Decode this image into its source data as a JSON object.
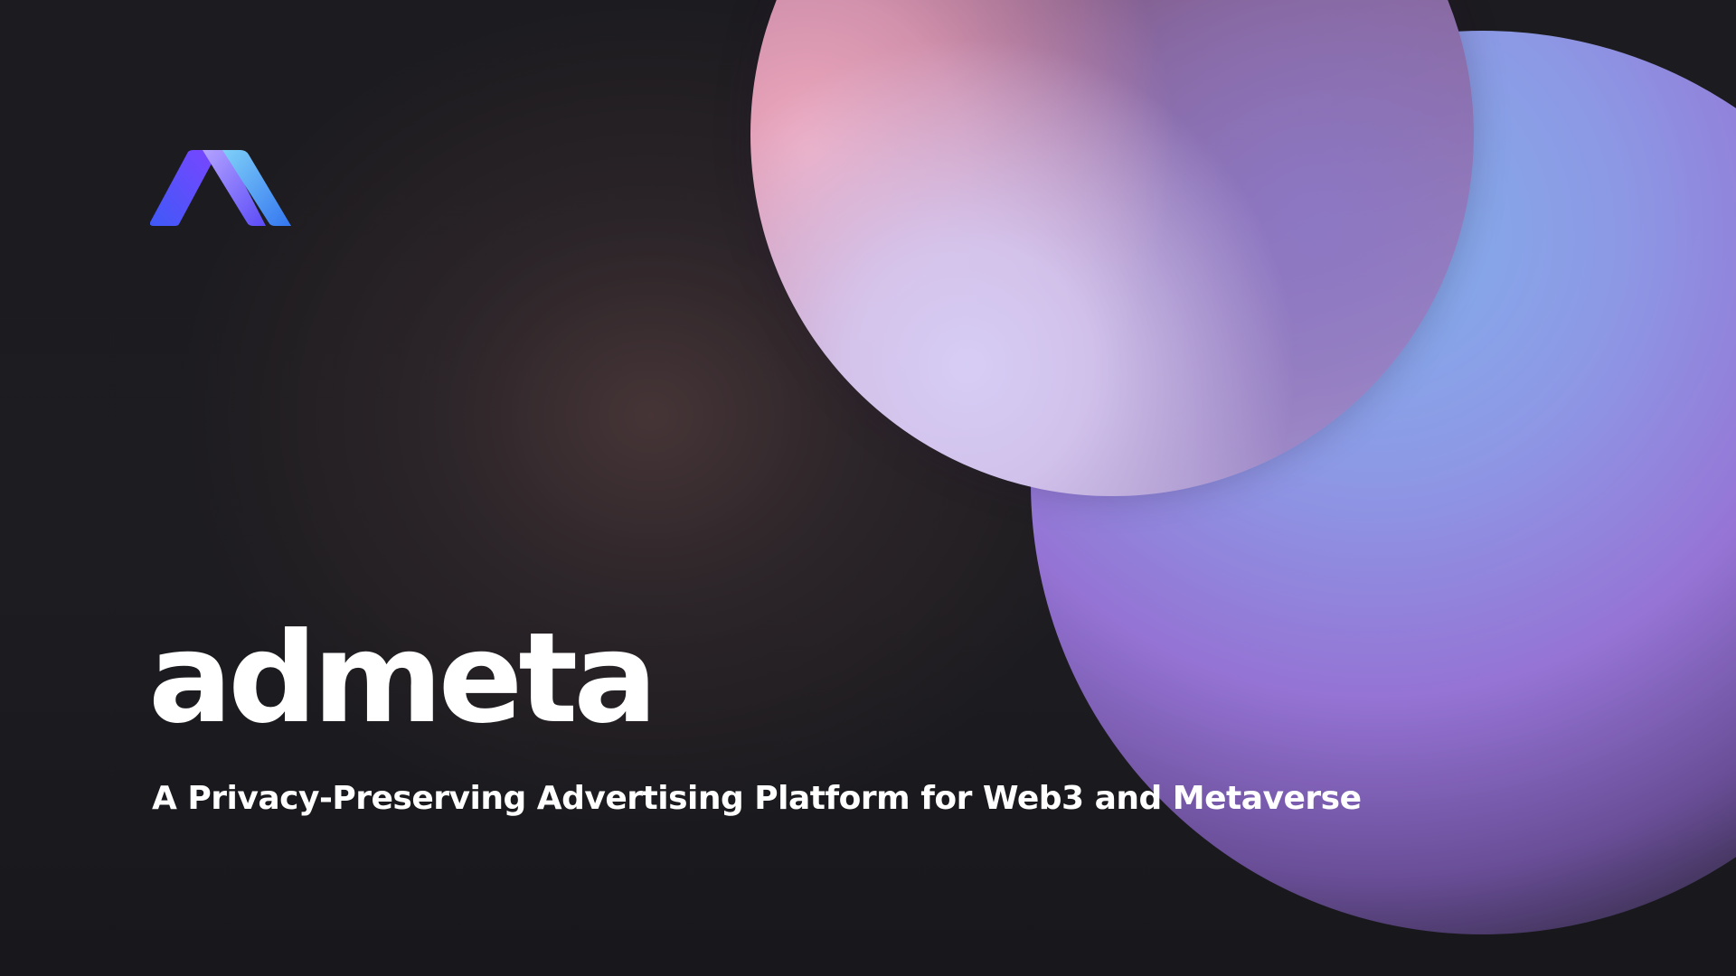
{
  "slide": {
    "brand_name": "admeta",
    "tagline": "A Privacy-Preserving Advertising Platform for Web3 and Metaverse",
    "logo": {
      "icon": "admeta-logo-icon",
      "colors": {
        "left_stroke": "#6f4dfb",
        "middle_stroke": "#8f7dff",
        "right_stroke": "#55a7f5"
      }
    },
    "colors": {
      "background": "#1b1b1f",
      "text": "#ffffff",
      "pink_sphere": "#e8a9c1",
      "lavender_highlight": "#d8d0f3",
      "blue_orb": "#84b3f0",
      "purple_glow": "#9775d8"
    }
  }
}
